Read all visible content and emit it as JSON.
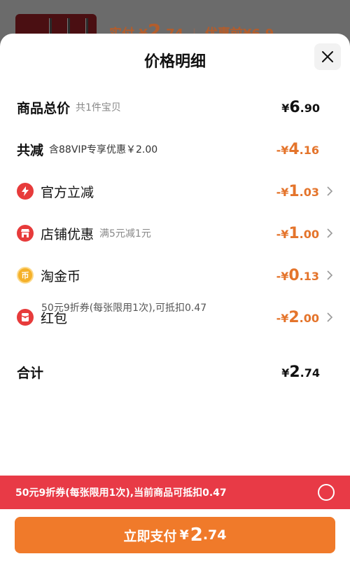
{
  "background": {
    "pay_prefix": "实付",
    "price_symbol": "¥",
    "price_int": "2",
    "price_dec": ".74",
    "sep": "|",
    "original_label": "优惠前¥6.9"
  },
  "sheet": {
    "title": "价格明细",
    "close_icon": "close-icon"
  },
  "rows": {
    "total": {
      "label": "商品总价",
      "sub": "共1件宝贝",
      "symbol": "¥",
      "int": "6",
      "dec": ".90"
    },
    "reduce": {
      "label": "共减",
      "sub": "含88VIP专享优惠￥2.00",
      "symbol": "-¥",
      "int": "4",
      "dec": ".16"
    },
    "official": {
      "label": "官方立减",
      "symbol": "-¥",
      "int": "1",
      "dec": ".03",
      "icon": "lightning-icon"
    },
    "store": {
      "label": "店铺优惠",
      "sub": "满5元减1元",
      "symbol": "-¥",
      "int": "1",
      "dec": ".00",
      "icon": "store-icon"
    },
    "coin": {
      "label": "淘金币",
      "symbol": "-¥",
      "int": "0",
      "dec": ".13",
      "icon": "coin-icon"
    },
    "redpacket": {
      "label": "红包",
      "symbol": "-¥",
      "int": "2",
      "dec": ".00",
      "icon": "red-packet-icon",
      "note": "50元9折券(每张限用1次),可抵扣0.47"
    },
    "sum": {
      "label": "合计",
      "symbol": "¥",
      "int": "2",
      "dec": ".74"
    }
  },
  "coupon_bar": {
    "text": "50元9折券(每张限用1次),当前商品可抵扣0.47",
    "selected": false
  },
  "pay_button": {
    "label": "立即支付",
    "symbol": "¥",
    "int": "2",
    "dec": ".74"
  },
  "colors": {
    "accent_orange": "#f07a2a",
    "coupon_red": "#e83a46",
    "discount_text": "#e4742b"
  }
}
